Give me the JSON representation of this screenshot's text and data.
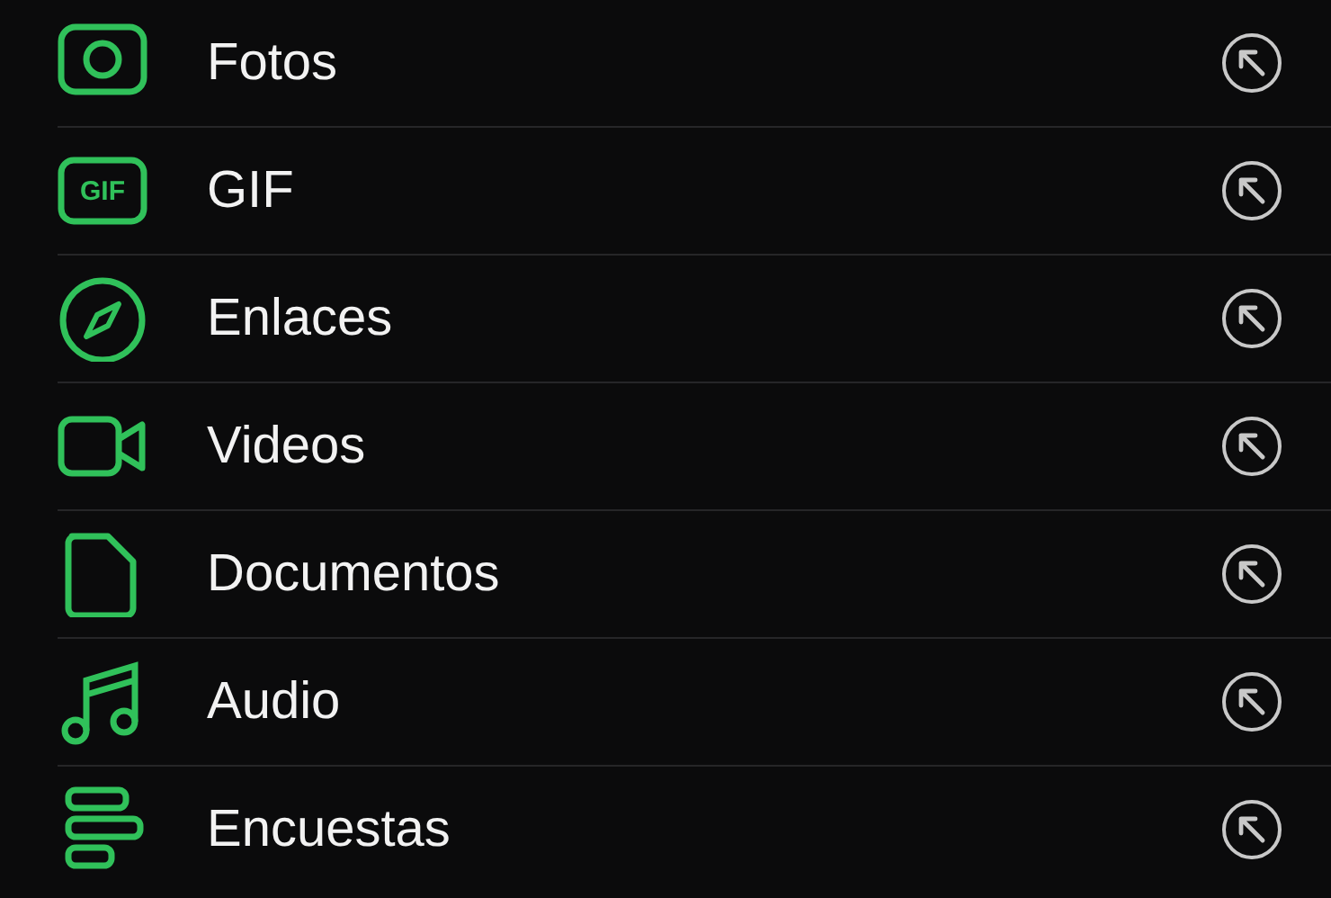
{
  "items": [
    {
      "kind": "camera",
      "label": "Fotos"
    },
    {
      "kind": "gif",
      "badge": "GIF",
      "label": "GIF"
    },
    {
      "kind": "compass",
      "label": "Enlaces"
    },
    {
      "kind": "video",
      "label": "Videos"
    },
    {
      "kind": "document",
      "label": "Documentos"
    },
    {
      "kind": "music",
      "label": "Audio"
    },
    {
      "kind": "poll",
      "label": "Encuestas"
    }
  ]
}
